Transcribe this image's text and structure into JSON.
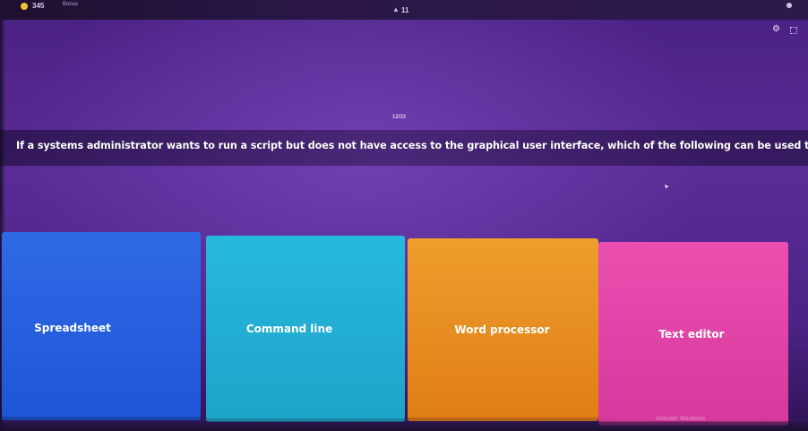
{
  "topbar": {
    "score": "345",
    "bonus_label": "Bonus",
    "streak": "11",
    "coin_icon": "coin-icon",
    "streak_icon": "flame-icon"
  },
  "controls": {
    "settings_icon": "gear-icon",
    "fullscreen_icon": "fullscreen-icon"
  },
  "quiz": {
    "counter": "12/33",
    "question": "If a systems administrator wants to run a script but does not have access to the graphical user interface, which of the following can be used to run scripts?",
    "answers": [
      {
        "label": "Spreadsheet",
        "color": "#2563e0"
      },
      {
        "label": "Command line",
        "color": "#22afd6"
      },
      {
        "label": "Word processor",
        "color": "#ea8e22"
      },
      {
        "label": "Text editor",
        "color": "#e245a6"
      }
    ]
  },
  "system": {
    "watermark": "Activate Windows"
  }
}
